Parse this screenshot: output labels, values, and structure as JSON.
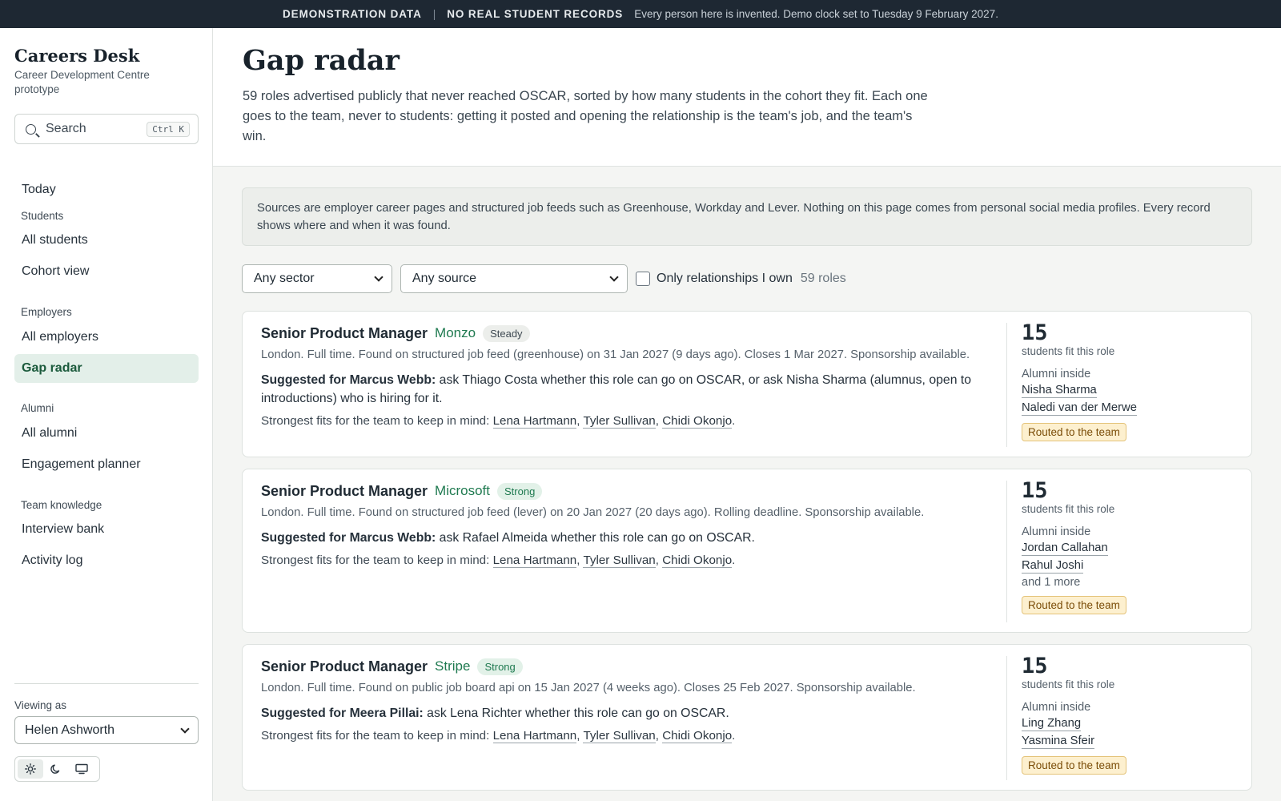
{
  "banner": {
    "label1": "DEMONSTRATION DATA",
    "separator": "|",
    "label2": "NO REAL STUDENT RECORDS",
    "note": "Every person here is invented. Demo clock set to Tuesday 9 February 2027."
  },
  "sidebar": {
    "brand_title": "Careers Desk",
    "brand_subtitle": "Career Development Centre prototype",
    "search_label": "Search",
    "search_shortcut": "Ctrl K",
    "today": "Today",
    "groups": {
      "students": {
        "label": "Students",
        "items": [
          "All students",
          "Cohort view"
        ]
      },
      "employers": {
        "label": "Employers",
        "items": [
          "All employers",
          "Gap radar"
        ]
      },
      "alumni": {
        "label": "Alumni",
        "items": [
          "All alumni",
          "Engagement planner"
        ]
      },
      "team": {
        "label": "Team knowledge",
        "items": [
          "Interview bank",
          "Activity log"
        ]
      }
    },
    "active_item": "Gap radar",
    "viewing_as_label": "Viewing as",
    "viewing_as_value": "Helen Ashworth",
    "theme_icons": [
      "sun-icon",
      "moon-icon",
      "monitor-icon"
    ]
  },
  "header": {
    "title": "Gap radar",
    "intro": "59 roles advertised publicly that never reached OSCAR, sorted by how many students in the cohort they fit. Each one goes to the team, never to students: getting it posted and opening the relationship is the team's job, and the team's win."
  },
  "notice": "Sources are employer career pages and structured job feeds such as Greenhouse, Workday and Lever. Nothing on this page comes from personal social media profiles. Every record shows where and when it was found.",
  "filters": {
    "sector": "Any sector",
    "source": "Any source",
    "only_mine_label": "Only relationships I own",
    "count": "59 roles"
  },
  "roles": [
    {
      "title": "Senior Product Manager",
      "employer": "Monzo",
      "badge": "Steady",
      "meta": "London. Full time. Found on structured job feed (greenhouse) on 31 Jan 2027 (9 days ago). Closes 1 Mar 2027. Sponsorship available.",
      "suggest_lead": "Suggested for Marcus Webb:",
      "suggest_text": " ask Thiago Costa whether this role can go on OSCAR, or ask Nisha Sharma (alumnus, open to introductions) who is hiring for it.",
      "fits_prefix": "Strongest fits for the team to keep in mind: ",
      "fits": [
        "Lena Hartmann",
        "Tyler Sullivan",
        "Chidi Okonjo"
      ],
      "fit_count": "15",
      "fit_label": "students fit this role",
      "alumni_label": "Alumni inside",
      "alumni": [
        "Nisha Sharma",
        "Naledi van der Merwe"
      ],
      "alumni_more": "",
      "status": "Routed to the team"
    },
    {
      "title": "Senior Product Manager",
      "employer": "Microsoft",
      "badge": "Strong",
      "meta": "London. Full time. Found on structured job feed (lever) on 20 Jan 2027 (20 days ago). Rolling deadline. Sponsorship available.",
      "suggest_lead": "Suggested for Marcus Webb:",
      "suggest_text": " ask Rafael Almeida whether this role can go on OSCAR.",
      "fits_prefix": "Strongest fits for the team to keep in mind: ",
      "fits": [
        "Lena Hartmann",
        "Tyler Sullivan",
        "Chidi Okonjo"
      ],
      "fit_count": "15",
      "fit_label": "students fit this role",
      "alumni_label": "Alumni inside",
      "alumni": [
        "Jordan Callahan",
        "Rahul Joshi"
      ],
      "alumni_more": "and 1 more",
      "status": "Routed to the team"
    },
    {
      "title": "Senior Product Manager",
      "employer": "Stripe",
      "badge": "Strong",
      "meta": "London. Full time. Found on public job board api on 15 Jan 2027 (4 weeks ago). Closes 25 Feb 2027. Sponsorship available.",
      "suggest_lead": "Suggested for Meera Pillai:",
      "suggest_text": " ask Lena Richter whether this role can go on OSCAR.",
      "fits_prefix": "Strongest fits for the team to keep in mind: ",
      "fits": [
        "Lena Hartmann",
        "Tyler Sullivan",
        "Chidi Okonjo"
      ],
      "fit_count": "15",
      "fit_label": "students fit this role",
      "alumni_label": "Alumni inside",
      "alumni": [
        "Ling Zhang",
        "Yasmina Sfeir"
      ],
      "alumni_more": "",
      "status": "Routed to the team"
    }
  ]
}
